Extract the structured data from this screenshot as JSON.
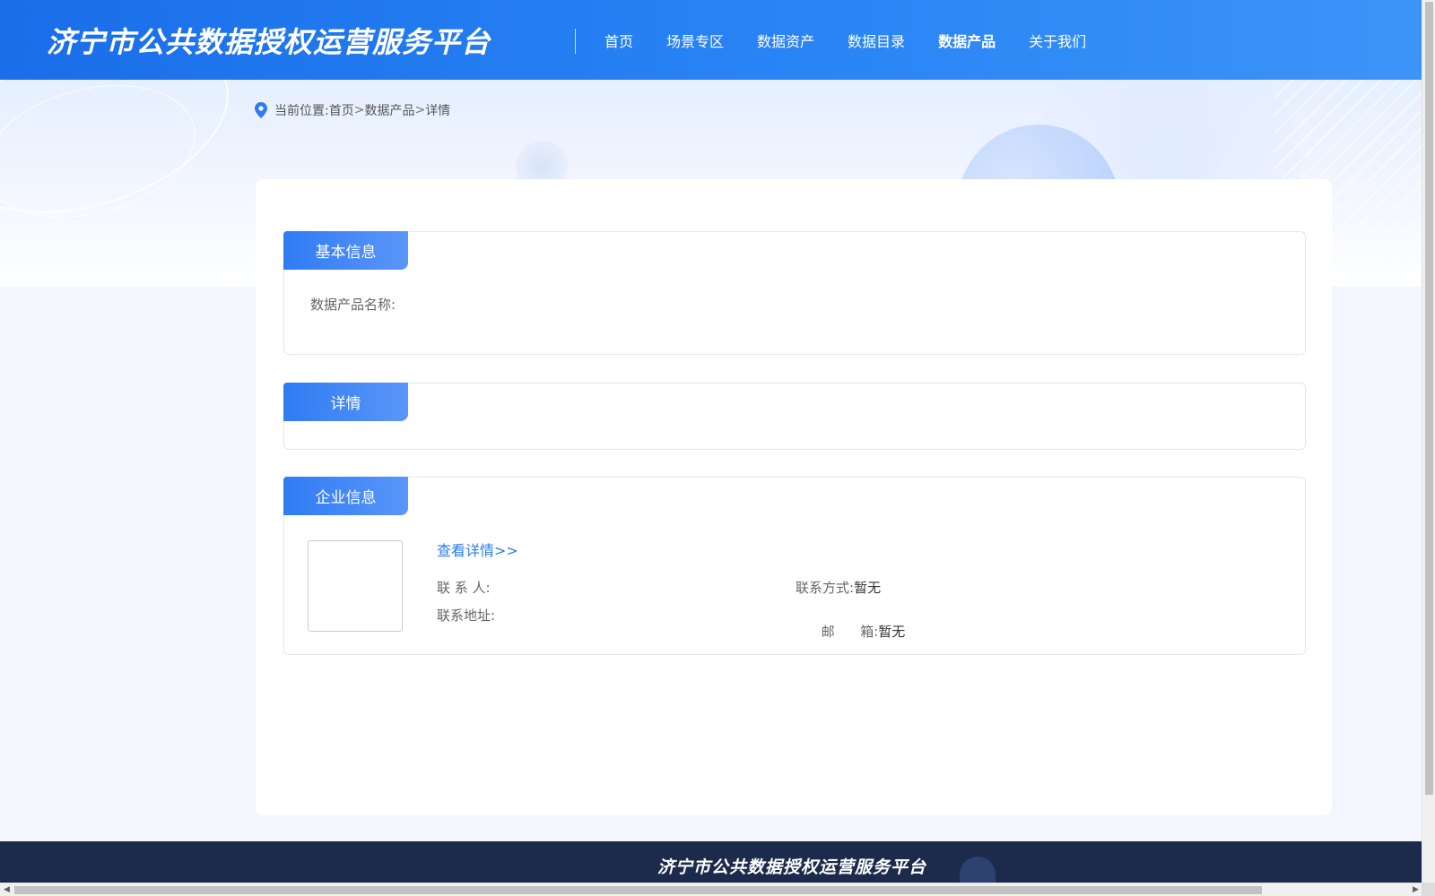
{
  "header": {
    "site_title": "济宁市公共数据授权运营服务平台",
    "nav": [
      {
        "label": "首页",
        "active": false
      },
      {
        "label": "场景专区",
        "active": false
      },
      {
        "label": "数据资产",
        "active": false
      },
      {
        "label": "数据目录",
        "active": false
      },
      {
        "label": "数据产品",
        "active": true
      },
      {
        "label": "关于我们",
        "active": false
      }
    ]
  },
  "breadcrumb": {
    "prefix": "当前位置:",
    "items": [
      "首页",
      "数据产品",
      "详情"
    ],
    "separator": ">",
    "icon": "location-pin-icon"
  },
  "sections": {
    "basic": {
      "title": "基本信息",
      "product_name_label": "数据产品名称:",
      "product_name_value": ""
    },
    "detail": {
      "title": "详情"
    },
    "company": {
      "title": "企业信息",
      "view_link": "查看详情>>",
      "contact_person_label": "联 系 人:",
      "contact_person_value": "",
      "contact_method_label": "联系方式:",
      "contact_method_value": "暂无",
      "address_label": "联系地址:",
      "address_value": "",
      "email_label": "邮      箱:",
      "email_value": "暂无"
    }
  },
  "footer": {
    "site_title": "济宁市公共数据授权运营服务平台"
  },
  "colors": {
    "header_blue": "#1a6ee9",
    "accent_blue": "#2f7bf3",
    "link_blue": "#2b7de9",
    "footer_navy": "#1c2b4b"
  }
}
